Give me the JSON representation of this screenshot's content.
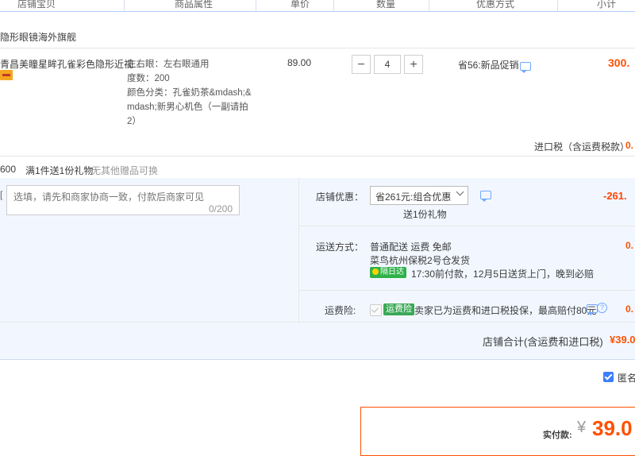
{
  "header": {
    "cols": [
      "店铺宝贝",
      "商品属性",
      "单价",
      "数量",
      "优惠方式",
      "小计"
    ]
  },
  "shop": {
    "name": "隐形眼镜海外旗舰"
  },
  "item": {
    "title": "青昌美瞳星眸孔雀彩色隐形近视...",
    "attrs": [
      "左右眼：左右眼通用",
      "度数：200",
      "颜色分类：孔雀奶茶&mdash;&",
      "mdash;新男心机色（一副请拍",
      "2）"
    ],
    "price": "89.00",
    "quantity": "4",
    "minus": "−",
    "plus": "+",
    "promo": "省56:新品促销",
    "subtotal": "300.",
    "tax_label": "进口税（含运费税款）",
    "tax_value": "0."
  },
  "gift_row": {
    "prefix": "600",
    "gift": "满1件送1份礼物",
    "note": "无其他赠品可换"
  },
  "message": {
    "label": "[",
    "placeholder": "选填，请先和商家协商一致，付款后商家可见",
    "count": "0/200"
  },
  "shop_discount": {
    "label": "店铺优惠：",
    "selected": "省261元:组合优惠",
    "note": "送1份礼物",
    "value": "-261."
  },
  "shipping": {
    "label": "运送方式：",
    "line1": "普通配送 运费 免邮",
    "warehouse": "菜鸟杭州保税2号仓",
    "dispatch": "发货",
    "badge": "隔日达",
    "detail": "17:30前付款，12月5日送货上门，晚到必赔",
    "value": "0."
  },
  "insurance": {
    "label": "运费险:",
    "tag": "运费险",
    "text": "卖家已为运费和进口税投保，最高赔付80元",
    "help": "?",
    "value": "0."
  },
  "shop_total": {
    "label": "店铺合计(含运费和进口税)",
    "value": "¥39.0"
  },
  "anonymous": {
    "label": "匿名"
  },
  "payment": {
    "label": "实付款:",
    "currency": "¥",
    "amount": "39.0"
  },
  "colors": {
    "accent": "#ff5000",
    "blue_bg": "#f2f7ff",
    "checkbox": "#3d7eff"
  }
}
